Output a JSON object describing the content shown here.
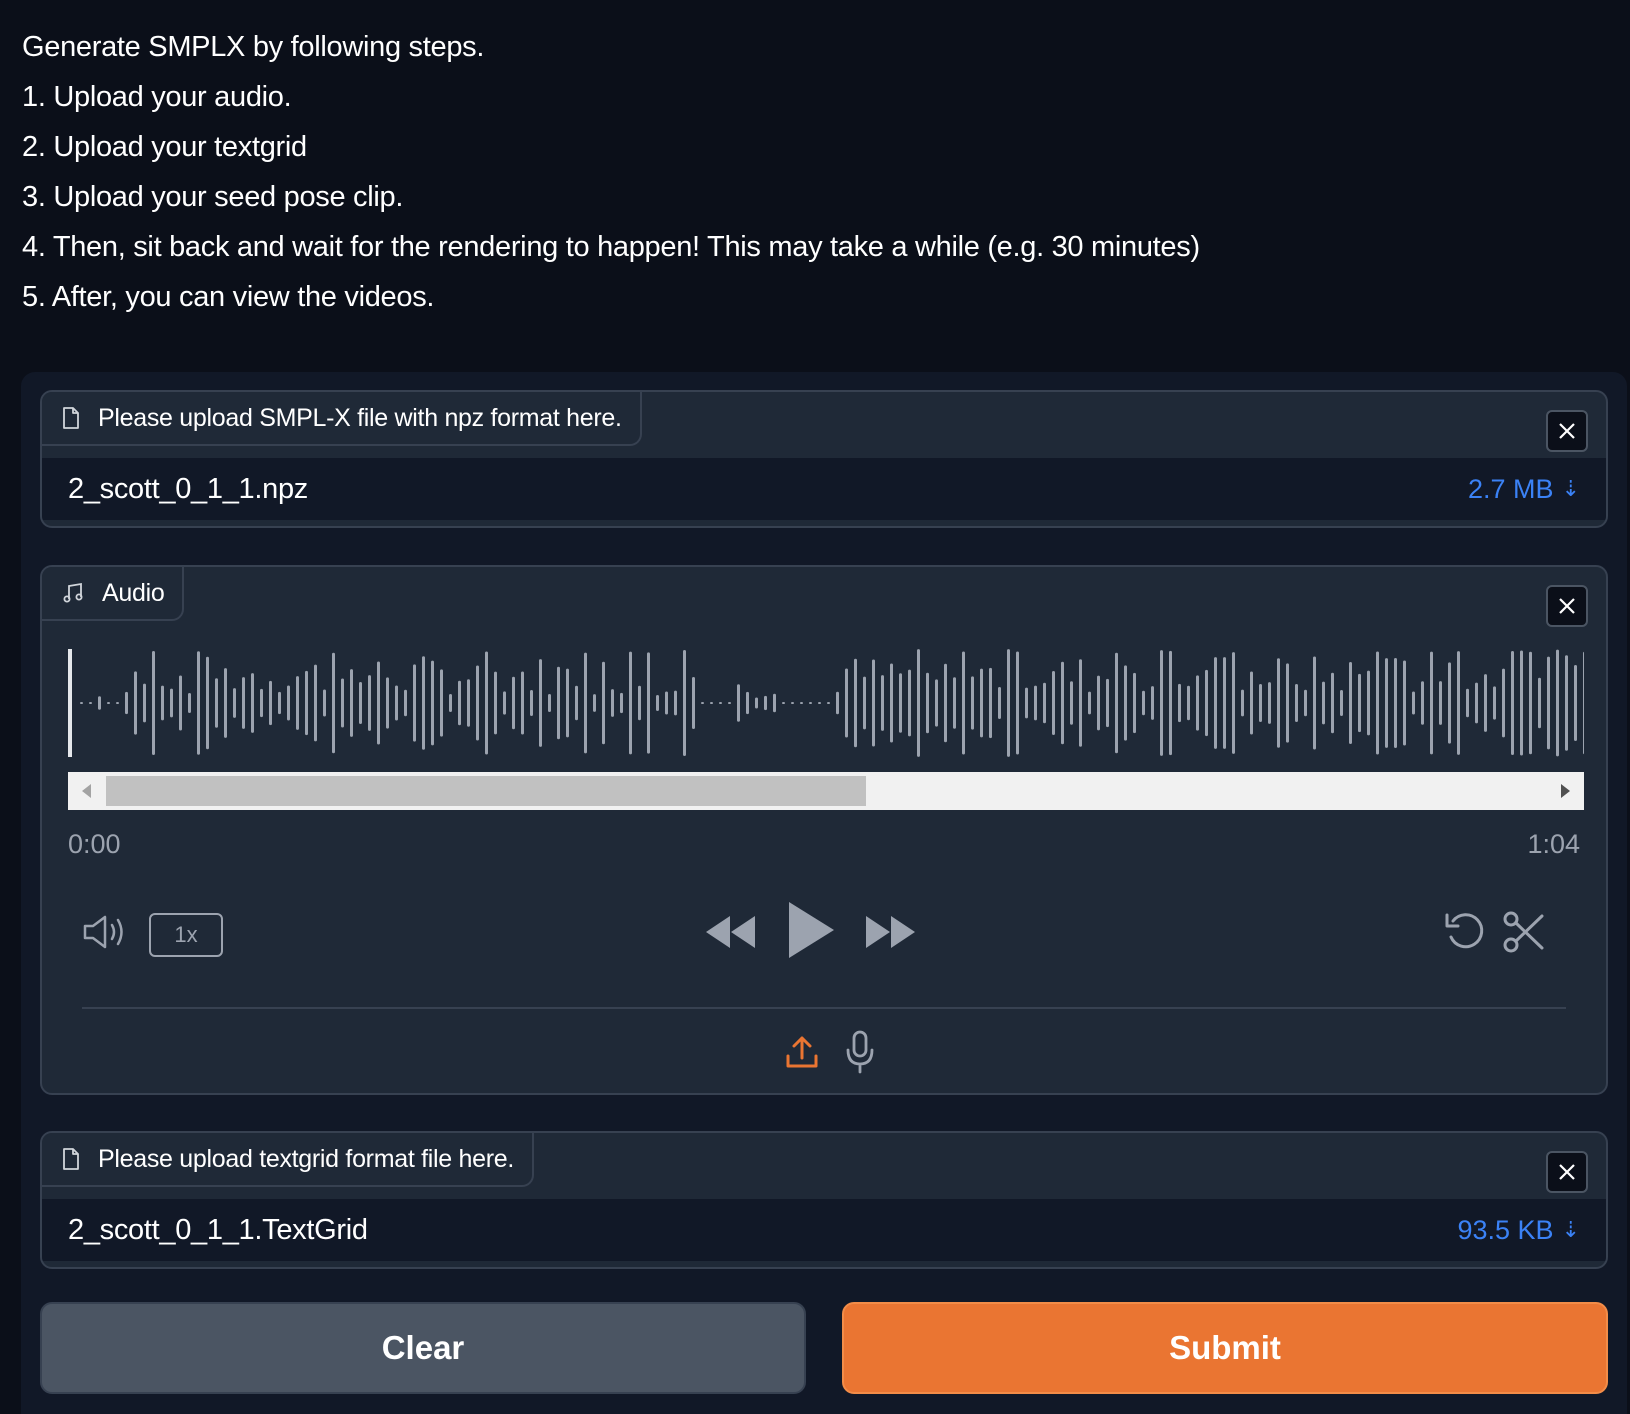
{
  "instructions": [
    "Generate SMPLX by following steps.",
    "1. Upload your audio.",
    "2. Upload your textgrid",
    "3. Upload your seed pose clip.",
    "4. Then, sit back and wait for the rendering to happen! This may take a while (e.g. 30 minutes)",
    "5. After, you can view the videos."
  ],
  "smplx_upload": {
    "label": "Please upload SMPL-X file with npz format here.",
    "file_name": "2_scott_0_1_1.npz",
    "file_size": "2.7 MB",
    "icon": "file-icon"
  },
  "audio": {
    "label": "Audio",
    "icon": "music-icon",
    "time_start": "0:00",
    "time_end": "1:04",
    "speed": "1x",
    "scroll_position": 0.0,
    "scroll_visible_fraction": 0.5
  },
  "textgrid_upload": {
    "label": "Please upload textgrid format file here.",
    "file_name": "2_scott_0_1_1.TextGrid",
    "file_size": "93.5 KB",
    "icon": "file-icon"
  },
  "buttons": {
    "clear": "Clear",
    "submit": "Submit"
  },
  "colors": {
    "background": "#0b0f19",
    "panel": "#111827",
    "block": "#1f2937",
    "accent": "#ea7532",
    "link": "#3b82f6"
  }
}
